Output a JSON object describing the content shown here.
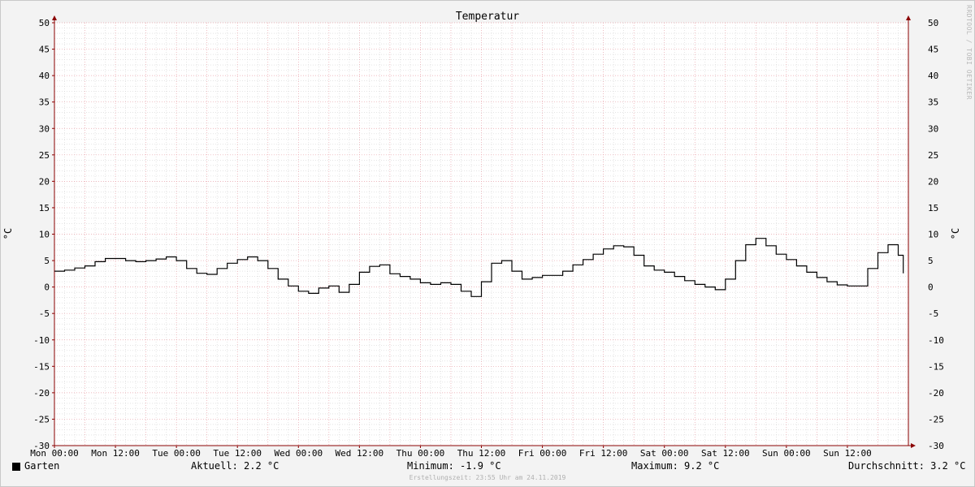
{
  "chart_data": {
    "type": "line",
    "title": "Temperatur",
    "ylabel": "°C",
    "xlabel": "",
    "ylim": [
      -30,
      50
    ],
    "y_ticks": [
      50,
      45,
      40,
      35,
      30,
      25,
      20,
      15,
      10,
      5,
      0,
      -5,
      -10,
      -15,
      -20,
      -25,
      -30
    ],
    "x_ticks": [
      "Mon 00:00",
      "Mon 12:00",
      "Tue 00:00",
      "Tue 12:00",
      "Wed 00:00",
      "Wed 12:00",
      "Thu 00:00",
      "Thu 12:00",
      "Fri 00:00",
      "Fri 12:00",
      "Sat 00:00",
      "Sat 00:00",
      "Sat 12:00",
      "Sun 00:00",
      "Sun 12:00"
    ],
    "x_tick_hours": [
      0,
      12,
      24,
      36,
      48,
      60,
      72,
      84,
      96,
      108,
      120,
      132,
      144,
      156
    ],
    "x_range_hours": [
      0,
      168
    ],
    "grid": true,
    "line_color": "#000000",
    "grid_colors": {
      "major": "#e8a0a8",
      "minor": "#d4d4d4",
      "axis": "#8b0000"
    },
    "series": [
      {
        "name": "Garten",
        "x_hours": [
          0,
          2,
          4,
          6,
          8,
          10,
          12,
          14,
          16,
          18,
          20,
          22,
          24,
          26,
          28,
          30,
          32,
          34,
          36,
          38,
          40,
          42,
          44,
          46,
          48,
          50,
          52,
          54,
          56,
          58,
          60,
          62,
          64,
          66,
          68,
          70,
          72,
          74,
          76,
          78,
          80,
          82,
          84,
          86,
          88,
          90,
          92,
          94,
          96,
          98,
          100,
          102,
          104,
          106,
          108,
          110,
          112,
          114,
          116,
          118,
          120,
          122,
          124,
          126,
          128,
          130,
          132,
          134,
          136,
          138,
          140,
          142,
          144,
          146,
          148,
          150,
          152,
          154,
          156,
          158,
          160,
          162,
          164,
          166,
          167
        ],
        "values": [
          3.0,
          3.2,
          3.6,
          4.0,
          4.8,
          5.4,
          5.4,
          5.0,
          4.8,
          5.0,
          5.3,
          5.7,
          5.0,
          3.5,
          2.6,
          2.4,
          3.5,
          4.5,
          5.2,
          5.7,
          5.0,
          3.5,
          1.5,
          0.2,
          -0.8,
          -1.2,
          -0.2,
          0.2,
          -1.0,
          0.5,
          2.8,
          3.9,
          4.2,
          2.5,
          2.0,
          1.5,
          0.8,
          0.5,
          0.8,
          0.5,
          -0.8,
          -1.8,
          1.0,
          4.5,
          5.0,
          3.0,
          1.5,
          1.8,
          2.2,
          2.2,
          3.0,
          4.2,
          5.2,
          6.2,
          7.2,
          7.8,
          7.6,
          6.0,
          4.0,
          3.2,
          2.8,
          2.0,
          1.2,
          0.5,
          0.0,
          -0.5,
          1.5,
          5.0,
          8.0,
          9.2,
          7.8,
          6.2,
          5.2,
          4.0,
          2.8,
          1.8,
          1.0,
          0.4,
          0.2,
          0.2,
          3.5,
          6.5,
          8.0,
          6.0,
          2.6,
          2.2,
          2.2
        ]
      }
    ]
  },
  "legend": {
    "series_name": "Garten",
    "current": "Aktuell: 2.2 °C",
    "minimum": "Minimum: -1.9 °C",
    "maximum": "Maximum: 9.2 °C",
    "average": "Durchschnitt: 3.2 °C"
  },
  "footer": "Erstellungszeit: 23:55 Uhr am 24.11.2019",
  "watermark": "RRDTOOL / TOBI OETIKER"
}
